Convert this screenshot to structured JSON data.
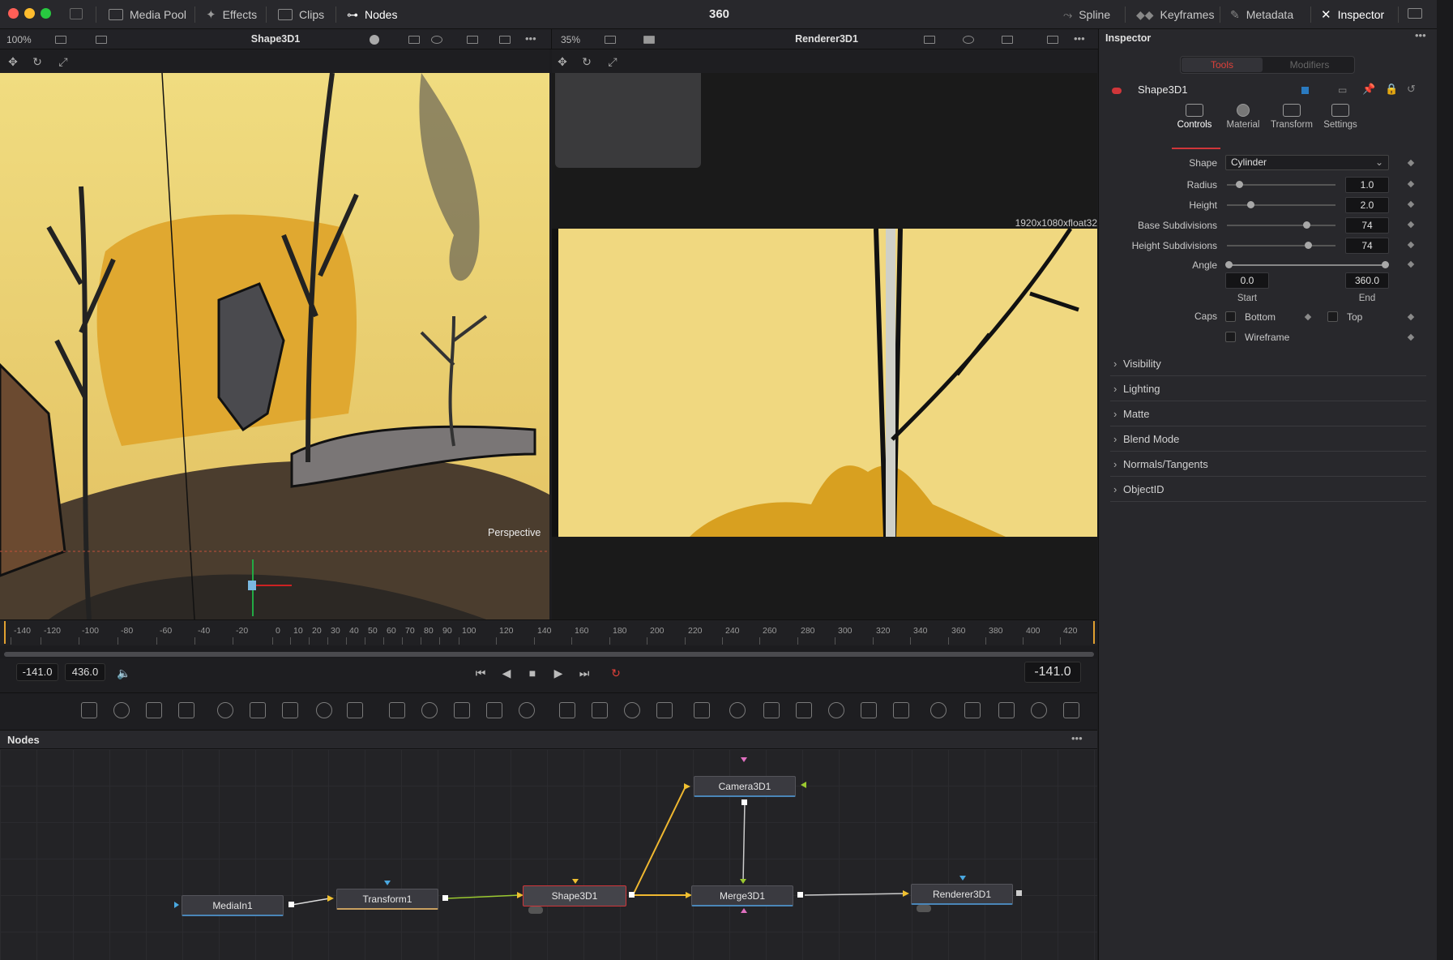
{
  "topbar": {
    "title": "360",
    "left_tabs": [
      "Media Pool",
      "Effects",
      "Clips",
      "Nodes"
    ],
    "right_tabs": [
      "Spline",
      "Keyframes",
      "Metadata",
      "Inspector"
    ]
  },
  "viewer1": {
    "zoom": "100%",
    "title": "Shape3D1",
    "label": "Perspective"
  },
  "viewer2": {
    "zoom": "35%",
    "title": "Renderer3D1",
    "resolution": "1920x1080xfloat32"
  },
  "ruler": {
    "ticks": [
      "-140",
      "-120",
      "-100",
      "-80",
      "-60",
      "-40",
      "-20",
      "0",
      "10",
      "20",
      "30",
      "40",
      "50",
      "60",
      "70",
      "80",
      "90",
      "100",
      "120",
      "140",
      "160",
      "180",
      "200",
      "220",
      "240",
      "260",
      "280",
      "300",
      "320",
      "340",
      "360",
      "380",
      "400",
      "420"
    ]
  },
  "transport": {
    "start": "-141.0",
    "end": "436.0",
    "current": "-141.0"
  },
  "nodes_panel": {
    "title": "Nodes",
    "nodes": [
      "MediaIn1",
      "Transform1",
      "Shape3D1",
      "Camera3D1",
      "Merge3D1",
      "Renderer3D1"
    ]
  },
  "inspector": {
    "title": "Inspector",
    "tabs": [
      "Tools",
      "Modifiers"
    ],
    "tool_name": "Shape3D1",
    "subtabs": [
      "Controls",
      "Material",
      "Transform",
      "Settings"
    ],
    "shape_label": "Shape",
    "shape_value": "Cylinder",
    "params": [
      {
        "label": "Radius",
        "value": "1.0",
        "level": 0.1
      },
      {
        "label": "Height",
        "value": "2.0",
        "level": 0.2
      },
      {
        "label": "Base Subdivisions",
        "value": "74",
        "level": 0.72
      },
      {
        "label": "Height Subdivisions",
        "value": "74",
        "level": 0.73
      }
    ],
    "angle_label": "Angle",
    "angle_start": "0.0",
    "angle_end": "360.0",
    "start_label": "Start",
    "end_label": "End",
    "caps_label": "Caps",
    "bottom_label": "Bottom",
    "top_label": "Top",
    "wireframe_label": "Wireframe",
    "sections": [
      "Visibility",
      "Lighting",
      "Matte",
      "Blend Mode",
      "Normals/Tangents",
      "ObjectID"
    ]
  },
  "colors": {
    "accent": "#d0363a",
    "bg": "#1c1c1f",
    "panel": "#28282c"
  }
}
